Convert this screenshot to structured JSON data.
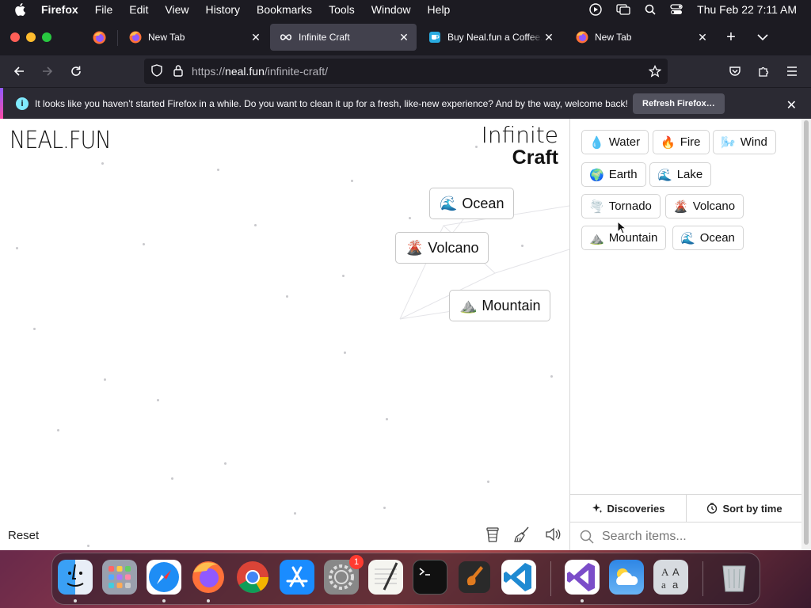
{
  "menubar": {
    "app": "Firefox",
    "items": [
      "File",
      "Edit",
      "View",
      "History",
      "Bookmarks",
      "Tools",
      "Window",
      "Help"
    ],
    "datetime": "Thu Feb 22  7:11 AM"
  },
  "tabs": [
    {
      "label": "New Tab",
      "icon": "firefox-icon"
    },
    {
      "label": "Infinite Craft",
      "icon": "infinity-icon",
      "active": true
    },
    {
      "label": "Buy Neal.fun a Coffee. ko",
      "icon": "kofi-icon"
    },
    {
      "label": "New Tab",
      "icon": "firefox-icon"
    }
  ],
  "url": {
    "scheme": "https://",
    "host": "neal.fun",
    "path": "/infinite-craft/"
  },
  "notice": {
    "text": "It looks like you haven’t started Firefox in a while. Do you want to clean it up for a fresh, like-new experience? And by the way, welcome back!",
    "button": "Refresh Firefox…"
  },
  "page": {
    "logo_left": "NEAL.FUN",
    "logo_right_line1": "Infinite",
    "logo_right_line2": "Craft",
    "reset": "Reset",
    "canvas_items": [
      {
        "emoji": "🌊",
        "label": "Ocean"
      },
      {
        "emoji": "🌋",
        "label": "Volcano"
      },
      {
        "emoji": "⛰️",
        "label": "Mountain"
      }
    ],
    "sidebar_items": [
      {
        "emoji": "💧",
        "label": "Water"
      },
      {
        "emoji": "🔥",
        "label": "Fire"
      },
      {
        "emoji": "🌬️",
        "label": "Wind"
      },
      {
        "emoji": "🌍",
        "label": "Earth"
      },
      {
        "emoji": "🌊",
        "label": "Lake"
      },
      {
        "emoji": "🌪️",
        "label": "Tornado"
      },
      {
        "emoji": "🌋",
        "label": "Volcano"
      },
      {
        "emoji": "⛰️",
        "label": "Mountain"
      },
      {
        "emoji": "🌊",
        "label": "Ocean"
      }
    ],
    "discoveries_label": "Discoveries",
    "sort_label": "Sort by time",
    "search_placeholder": "Search items..."
  },
  "dock": {
    "notification_badge": "1"
  }
}
